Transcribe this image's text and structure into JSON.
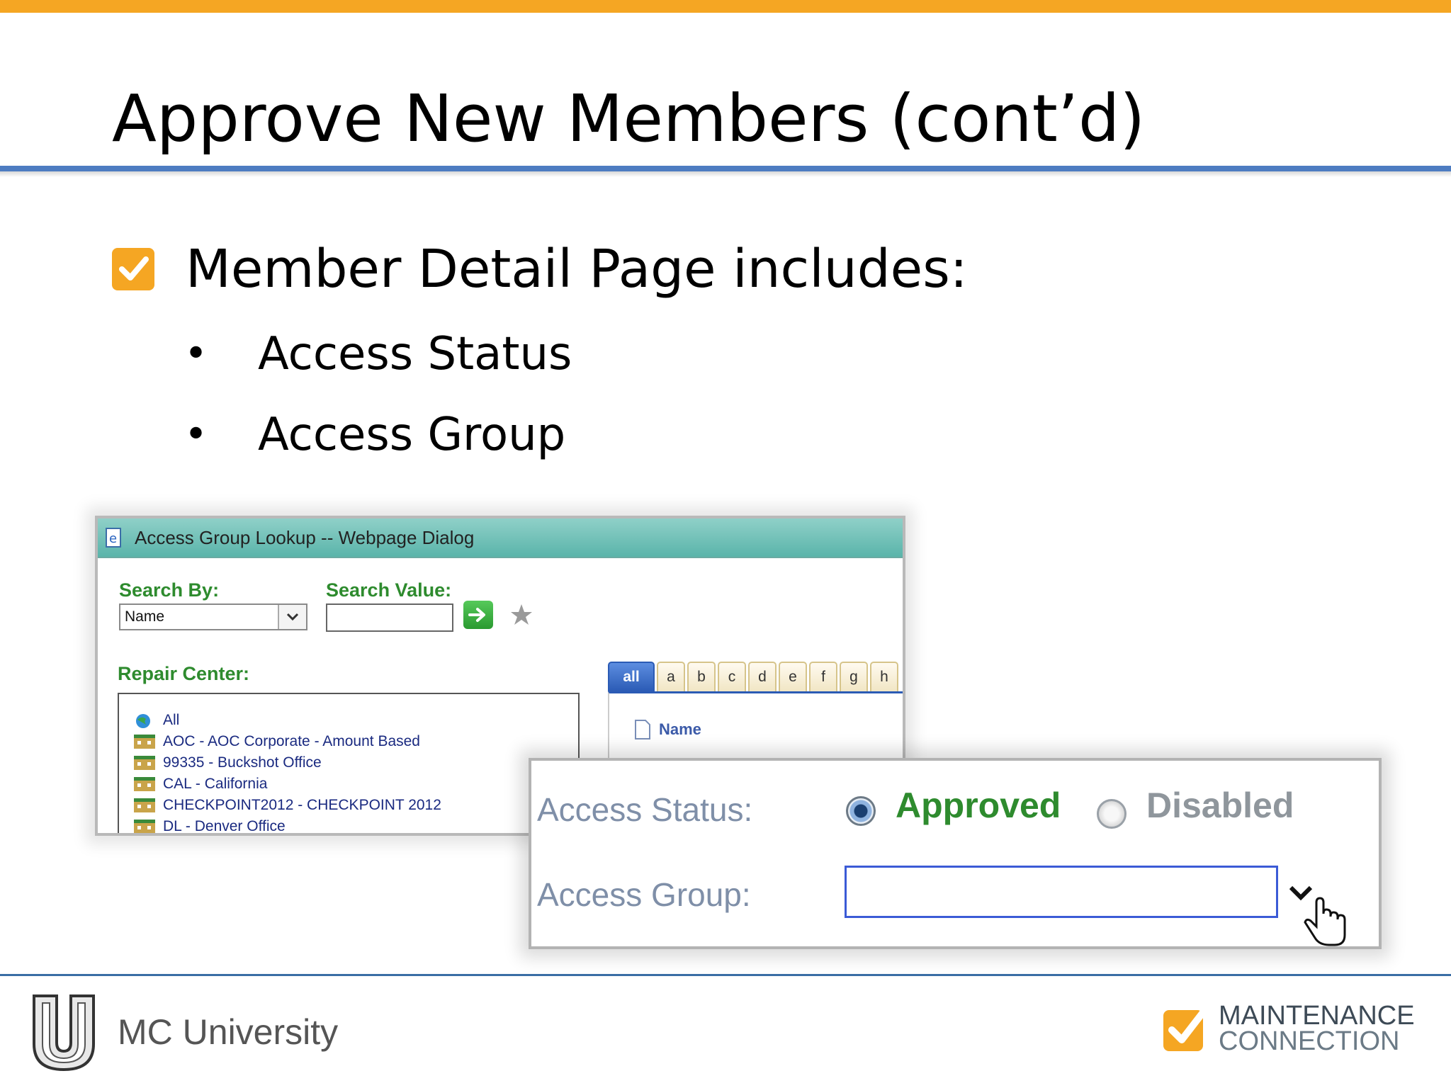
{
  "slide": {
    "title": "Approve New Members (cont’d)",
    "main_bullet": "Member Detail Page includes:",
    "sub_bullets": [
      "Access Status",
      "Access Group"
    ]
  },
  "dialog": {
    "title": "Access Group Lookup -- Webpage Dialog",
    "search_by_label": "Search By:",
    "search_by_value": "Name",
    "search_value_label": "Search Value:",
    "search_value": "",
    "repair_center_label": "Repair Center:",
    "repair_centers": [
      "All",
      "AOC - AOC Corporate - Amount Based",
      "99335 - Buckshot Office",
      "CAL - California",
      "CHECKPOINT2012 - CHECKPOINT 2012",
      "DL - Denver Office"
    ],
    "alpha_tabs": [
      "all",
      "a",
      "b",
      "c",
      "d",
      "e",
      "f",
      "g",
      "h"
    ],
    "active_tab": "all",
    "column_header": "Name"
  },
  "access_panel": {
    "status_label": "Access Status:",
    "status_options": [
      "Approved",
      "Disabled"
    ],
    "selected_status": "Approved",
    "group_label": "Access Group:",
    "group_value": ""
  },
  "footer": {
    "left_brand": "MC University",
    "right_brand_line1": "MAINTENANCE",
    "right_brand_line2": "CONNECTION"
  },
  "colors": {
    "accent_orange": "#f5a623",
    "rule_blue": "#4d7cc1",
    "green_label": "#2e8b2e"
  }
}
